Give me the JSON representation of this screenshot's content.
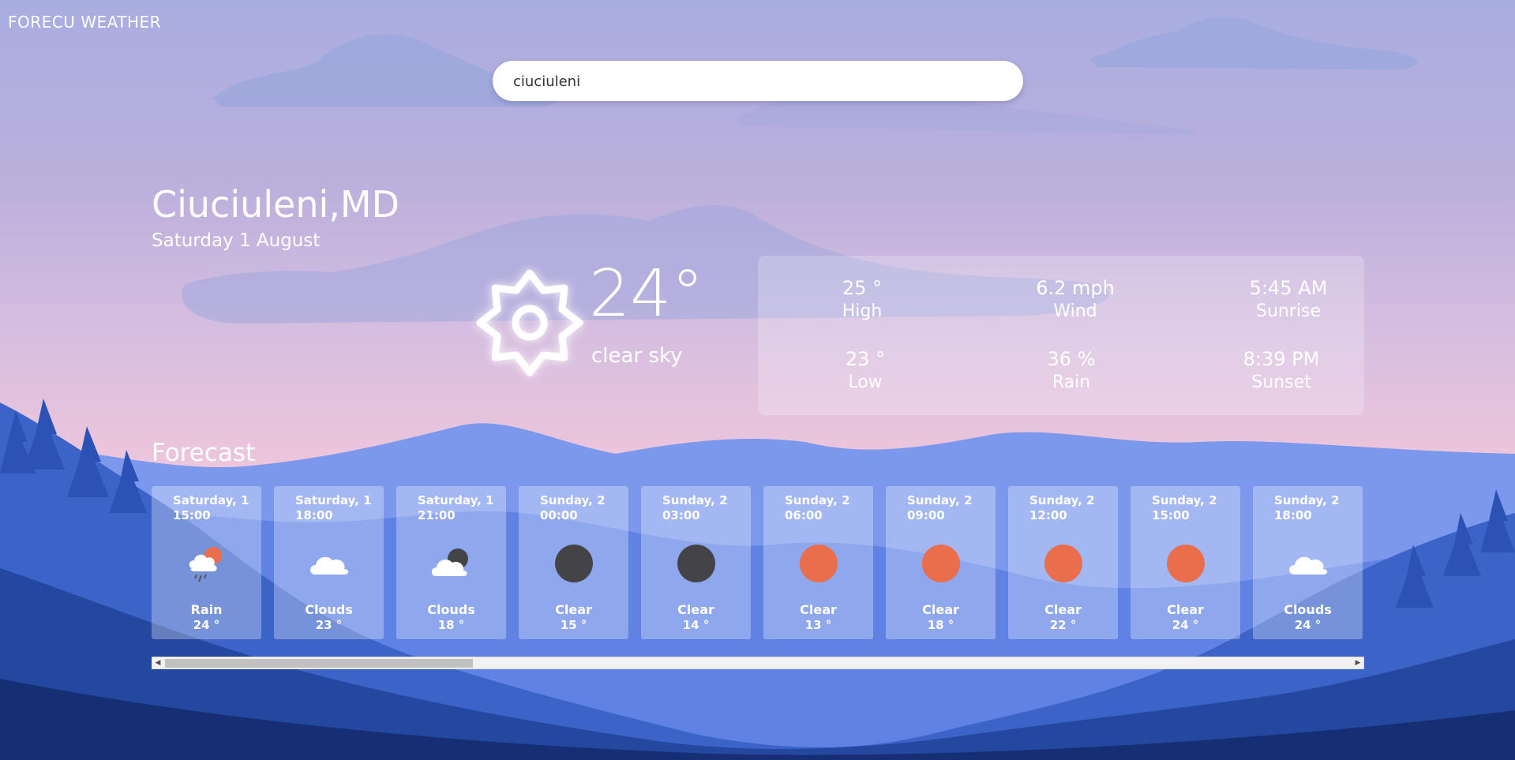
{
  "brand": "FORECU WEATHER",
  "search": {
    "value": "ciuciuleni",
    "placeholder": ""
  },
  "location": {
    "city": "Ciuciuleni,MD",
    "date": "Saturday 1 August"
  },
  "current": {
    "temp": "24°",
    "description": "clear sky",
    "icon": "sun-icon"
  },
  "stats": {
    "high": {
      "value": "25 °",
      "label": "High"
    },
    "wind": {
      "value": "6.2 mph",
      "label": "Wind"
    },
    "sunrise": {
      "value": "5:45 AM",
      "label": "Sunrise"
    },
    "low": {
      "value": "23 °",
      "label": "Low"
    },
    "rain": {
      "value": "36 %",
      "label": "Rain"
    },
    "sunset": {
      "value": "8:39 PM",
      "label": "Sunset"
    }
  },
  "forecast": {
    "title": "Forecast",
    "items": [
      {
        "day": "Saturday, 1",
        "time": "15:00",
        "condition": "Rain",
        "temp": "24 °",
        "icon": "rain-cloud-sun-icon"
      },
      {
        "day": "Saturday, 1",
        "time": "18:00",
        "condition": "Clouds",
        "temp": "23 °",
        "icon": "cloud-icon"
      },
      {
        "day": "Saturday, 1",
        "time": "21:00",
        "condition": "Clouds",
        "temp": "18 °",
        "icon": "cloud-moon-icon"
      },
      {
        "day": "Sunday, 2",
        "time": "00:00",
        "condition": "Clear",
        "temp": "15 °",
        "icon": "moon-icon"
      },
      {
        "day": "Sunday, 2",
        "time": "03:00",
        "condition": "Clear",
        "temp": "14 °",
        "icon": "moon-icon"
      },
      {
        "day": "Sunday, 2",
        "time": "06:00",
        "condition": "Clear",
        "temp": "13 °",
        "icon": "sun-icon"
      },
      {
        "day": "Sunday, 2",
        "time": "09:00",
        "condition": "Clear",
        "temp": "18 °",
        "icon": "sun-icon"
      },
      {
        "day": "Sunday, 2",
        "time": "12:00",
        "condition": "Clear",
        "temp": "22 °",
        "icon": "sun-icon"
      },
      {
        "day": "Sunday, 2",
        "time": "15:00",
        "condition": "Clear",
        "temp": "24 °",
        "icon": "sun-icon"
      },
      {
        "day": "Sunday, 2",
        "time": "18:00",
        "condition": "Clouds",
        "temp": "24 °",
        "icon": "cloud-icon"
      }
    ]
  },
  "colors": {
    "sun": "#ea6e4b",
    "moon": "#444448",
    "card": "rgba(255,255,255,0.3)",
    "mountain_dark": "#1d3f8f",
    "mountain_light": "#6f8ee8"
  }
}
